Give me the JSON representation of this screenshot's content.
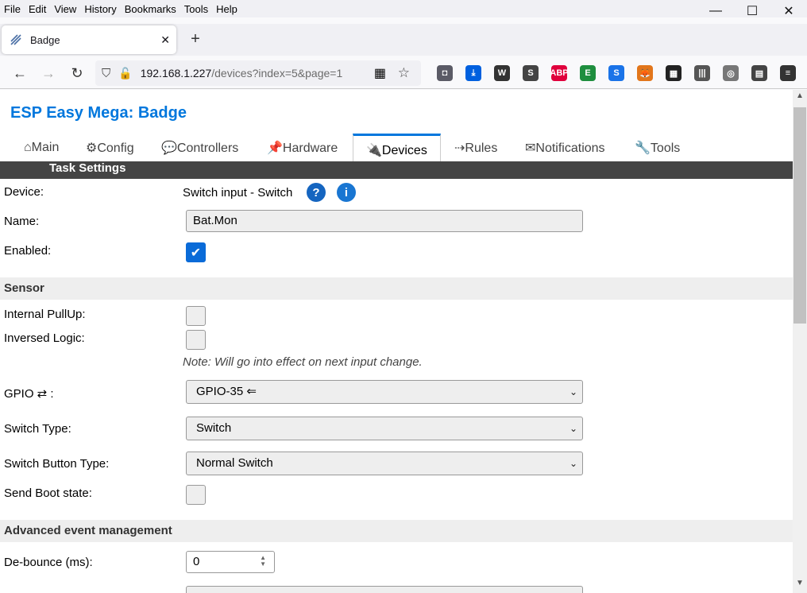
{
  "menu": [
    "File",
    "Edit",
    "View",
    "History",
    "Bookmarks",
    "Tools",
    "Help"
  ],
  "window_controls": {
    "minimize": "—",
    "maximize": "☐",
    "close": "✕"
  },
  "tab": {
    "title": "Badge",
    "close": "✕",
    "new": "+"
  },
  "url": {
    "host": "192.168.1.227",
    "path": "/devices?index=5&page=1"
  },
  "extensions": [
    {
      "name": "pocket-icon",
      "label": "◘",
      "color": "#5b5b66"
    },
    {
      "name": "download-icon",
      "label": "⤓",
      "color": "#0060df"
    },
    {
      "name": "wordpress-icon",
      "label": "W",
      "color": "#333333"
    },
    {
      "name": "skype-icon",
      "label": "S",
      "color": "#444444"
    },
    {
      "name": "adblock-icon",
      "label": "ABP",
      "color": "#e0003c"
    },
    {
      "name": "evernote-icon",
      "label": "E",
      "color": "#1e8e3e"
    },
    {
      "name": "s-extension-icon",
      "label": "S",
      "color": "#1a73e8"
    },
    {
      "name": "metamask-icon",
      "label": "🦊",
      "color": "#e2761b"
    },
    {
      "name": "grid-icon",
      "label": "▦",
      "color": "#222222"
    },
    {
      "name": "library-icon",
      "label": "|||",
      "color": "#555555"
    },
    {
      "name": "sync-icon",
      "label": "◎",
      "color": "#777777"
    },
    {
      "name": "reader-icon",
      "label": "▤",
      "color": "#444444"
    },
    {
      "name": "menu-icon",
      "label": "≡",
      "color": "#333333"
    }
  ],
  "page": {
    "title": "ESP Easy Mega: Badge",
    "tabs": [
      "⌂Main",
      "⚙Config",
      "💬Controllers",
      "📌Hardware",
      "🔌Devices",
      "⇢Rules",
      "✉Notifications",
      "🔧Tools"
    ],
    "active_tab": "Devices",
    "section": "Task Settings",
    "device_label": "Device:",
    "device_value": "Switch input - Switch",
    "help_q": "?",
    "help_i": "i",
    "name_label": "Name:",
    "name_value": "Bat.Mon",
    "enabled_label": "Enabled:",
    "sensor_head": "Sensor",
    "pullup_label": "Internal PullUp:",
    "inversed_label": "Inversed Logic:",
    "note": "Note: Will go into effect on next input change.",
    "gpio_label": "GPIO ⇄ :",
    "gpio_value": "GPIO-35 ⇐",
    "switch_type_label": "Switch Type:",
    "switch_type_value": "Switch",
    "button_type_label": "Switch Button Type:",
    "button_type_value": "Normal Switch",
    "boot_label": "Send Boot state:",
    "adv_head": "Advanced event management",
    "debounce_label": "De-bounce (ms):",
    "debounce_value": "0"
  }
}
